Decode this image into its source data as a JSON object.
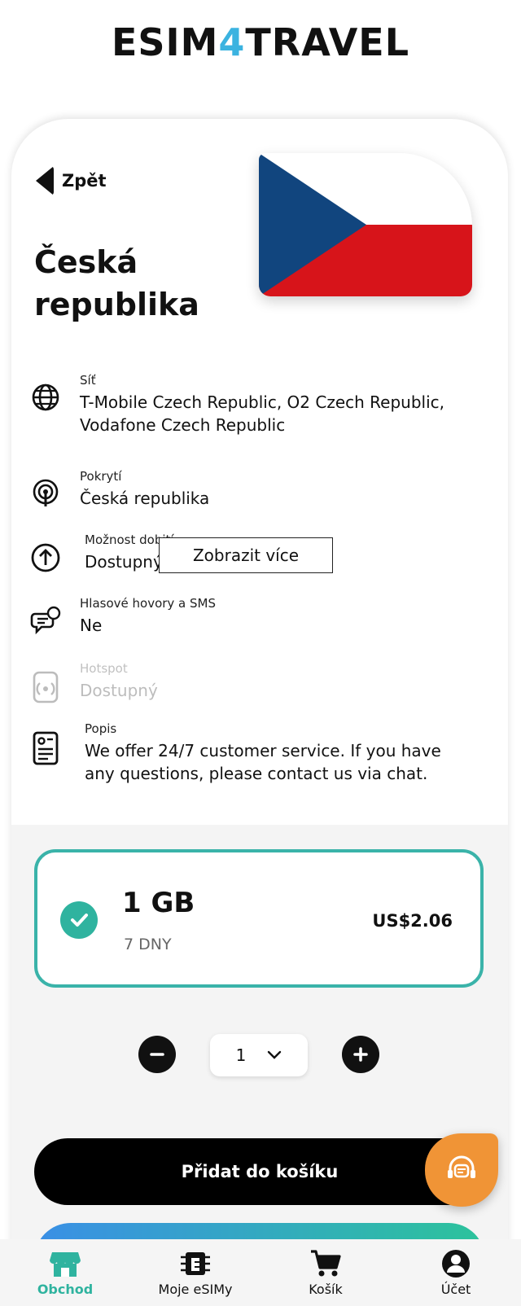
{
  "brand": {
    "logo_left": "ESIM",
    "logo_mid": "4",
    "logo_right": "TRAVEL"
  },
  "header": {
    "back_label": "Zpět",
    "title": "Česká republika"
  },
  "flag": {
    "colors": {
      "white": "#ffffff",
      "red": "#d7141a",
      "blue": "#11457e"
    }
  },
  "details": [
    {
      "icon": "globe-icon",
      "label": "Síť",
      "value": "T-Mobile Czech Republic, O2 Czech Republic, Vodafone Czech Republic"
    },
    {
      "icon": "coverage-antenna-icon",
      "label": "Pokrytí",
      "value": "Česká republika"
    },
    {
      "icon": "topup-arrow-icon",
      "label": "Možnost dobití",
      "value": "Dostupný"
    },
    {
      "icon": "phone-chat-icon",
      "label": "Hlasové hovory a SMS",
      "value": "Ne"
    },
    {
      "icon": "hotspot-icon",
      "label": "Hotspot",
      "value": "Dostupný"
    },
    {
      "icon": "description-document-icon",
      "label": "Popis",
      "value": "We offer 24/7 customer service. If you have any questions, please contact us via chat."
    }
  ],
  "show_more_label": "Zobrazit více",
  "plan": {
    "size": "1 GB",
    "duration": "7 DNY",
    "price": "US$2.06",
    "selected": true,
    "accent": "#3ab3a9"
  },
  "quantity": {
    "value": "1"
  },
  "add_to_cart_label": "Přidat do košíku",
  "nav": [
    {
      "label": "Obchod",
      "icon": "shop-icon",
      "active": true
    },
    {
      "label": "Moje eSIMy",
      "icon": "esim-chip-icon",
      "active": false
    },
    {
      "label": "Košík",
      "icon": "cart-icon",
      "active": false
    },
    {
      "label": "Účet",
      "icon": "account-icon",
      "active": false
    }
  ],
  "colors": {
    "accent": "#2fb39f",
    "chat": "#f09436",
    "logo_four": "#3bb3e0"
  }
}
